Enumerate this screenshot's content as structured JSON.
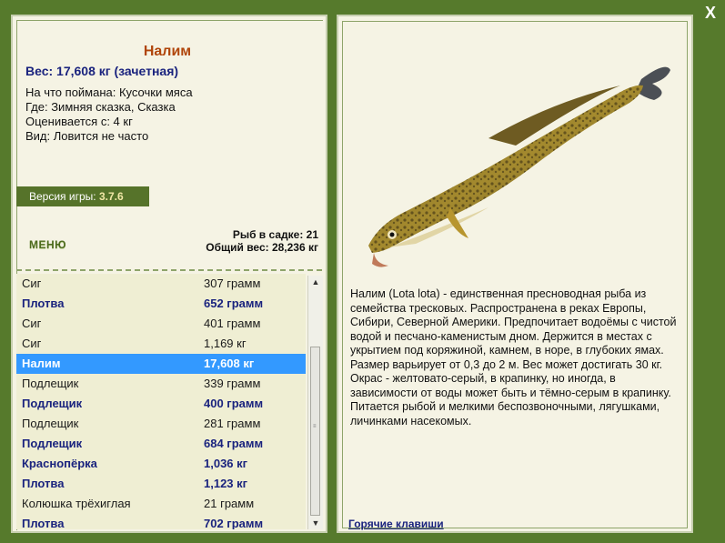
{
  "close_label": "X",
  "fish": {
    "name": "Налим",
    "weight": "Вес: 17,608 кг (зачетная)",
    "bait": "На что поймана: Кусочки мяса",
    "location": "Где: Зимняя сказка, Сказка",
    "rated_from": "Оценивается с: 4 кг",
    "rarity": "Вид: Ловится не часто"
  },
  "version": {
    "label": "Версия игры:",
    "value": "3.7.6"
  },
  "menu_label": "МЕНЮ",
  "stats": {
    "fish_in_keepnet": "Рыб в садке: 21",
    "total_weight": "Общий вес: 28,236 кг"
  },
  "catch_list": [
    {
      "name": "Сиг",
      "weight": "307 грамм",
      "style": "normal"
    },
    {
      "name": "Плотва",
      "weight": "652 грамм",
      "style": "bold"
    },
    {
      "name": "Сиг",
      "weight": "401 грамм",
      "style": "normal"
    },
    {
      "name": "Сиг",
      "weight": "1,169 кг",
      "style": "normal"
    },
    {
      "name": "Налим",
      "weight": "17,608 кг",
      "style": "selected"
    },
    {
      "name": "Подлещик",
      "weight": "339 грамм",
      "style": "normal"
    },
    {
      "name": "Подлещик",
      "weight": "400 грамм",
      "style": "bold"
    },
    {
      "name": "Подлещик",
      "weight": "281 грамм",
      "style": "normal"
    },
    {
      "name": "Подлещик",
      "weight": "684 грамм",
      "style": "bold"
    },
    {
      "name": "Краснопёрка",
      "weight": "1,036 кг",
      "style": "bold"
    },
    {
      "name": "Плотва",
      "weight": "1,123 кг",
      "style": "bold"
    },
    {
      "name": "Колюшка трёхиглая",
      "weight": "21 грамм",
      "style": "normal"
    },
    {
      "name": "Плотва",
      "weight": "702 грамм",
      "style": "bold"
    }
  ],
  "description": "Налим (Lota lota) - единственная пресноводная рыба из семейства тресковых. Распространена в реках Европы, Сибири, Северной Америки. Предпочитает водоёмы с чистой водой и песчано-каменистым дном. Держится в местах с укрытием под коряжиной, камнем, в норе, в глубоких ямах. Размер варьирует от 0,3 до 2 м. Вес может достигать 30 кг. Окрас - желтовато-серый, в крапинку, но иногда, в зависимости от воды может быть и тёмно-серым в крапинку. Питается рыбой и мелкими беспозвоночными, лягушками, личинками насекомых.",
  "hotkeys_label": "Горячие клавиши",
  "colors": {
    "background": "#567a2c",
    "panel": "#f5f3e4",
    "selected": "#3399ff",
    "accent_name": "#b0450a",
    "bold_text": "#1a237e"
  },
  "icons": {
    "close": "close-icon",
    "scroll_up": "arrow-up-icon",
    "scroll_down": "arrow-down-icon",
    "grip": "grip-icon"
  }
}
